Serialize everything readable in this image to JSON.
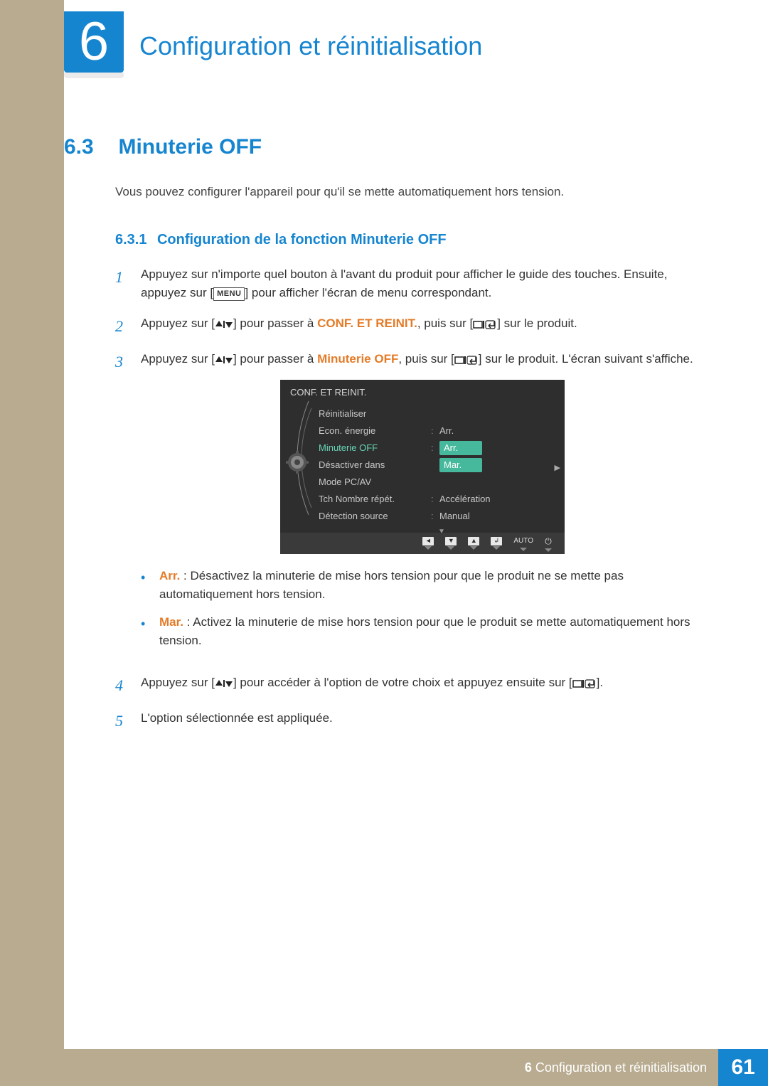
{
  "chapter": {
    "number": "6",
    "title": "Configuration et réinitialisation"
  },
  "section": {
    "number": "6.3",
    "title": "Minuterie OFF",
    "intro": "Vous pouvez configurer l'appareil pour qu'il se mette automatiquement hors tension."
  },
  "subsection": {
    "number": "6.3.1",
    "title": "Configuration de la fonction Minuterie OFF"
  },
  "steps": {
    "s1": "Appuyez sur n'importe quel bouton à l'avant du produit pour afficher le guide des touches. Ensuite, appuyez sur [",
    "s1b": "] pour afficher l'écran de menu correspondant.",
    "s2a": "Appuyez sur [",
    "s2b": "] pour passer à ",
    "s2c": "CONF. ET REINIT.",
    "s2d": ", puis sur [",
    "s2e": "] sur le produit.",
    "s3a": "Appuyez sur [",
    "s3b": "] pour passer à ",
    "s3c": "Minuterie OFF",
    "s3d": ", puis sur [",
    "s3e": "] sur le produit. L'écran suivant s'affiche.",
    "s4a": "Appuyez sur [",
    "s4b": "] pour accéder à l'option de votre choix et appuyez ensuite sur [",
    "s4c": "].",
    "s5": "L'option sélectionnée est appliquée."
  },
  "menu_label": "MENU",
  "bullets": {
    "arr_label": "Arr.",
    "arr_text": " : Désactivez la minuterie de mise hors tension pour que le produit ne se mette pas automatiquement hors tension.",
    "mar_label": "Mar.",
    "mar_text": " : Activez la minuterie de mise hors tension pour que le produit se mette automatiquement hors tension."
  },
  "osd": {
    "title": "CONF. ET REINIT.",
    "rows": {
      "r0": {
        "label": "Réinitialiser",
        "value": ""
      },
      "r1": {
        "label": "Econ. énergie",
        "value": "Arr."
      },
      "r2": {
        "label": "Minuterie OFF",
        "value_selected": "Arr.",
        "value_below": "Mar."
      },
      "r3": {
        "label": "Désactiver dans",
        "value": ""
      },
      "r4": {
        "label": "Mode PC/AV",
        "value": ""
      },
      "r5": {
        "label": "Tch Nombre répét.",
        "value": "Accélération"
      },
      "r6": {
        "label": "Détection source",
        "value": "Manual"
      }
    },
    "footer": {
      "auto": "AUTO"
    }
  },
  "footer": {
    "chapter_label": "6",
    "chapter_text": "Configuration et réinitialisation",
    "page": "61"
  }
}
